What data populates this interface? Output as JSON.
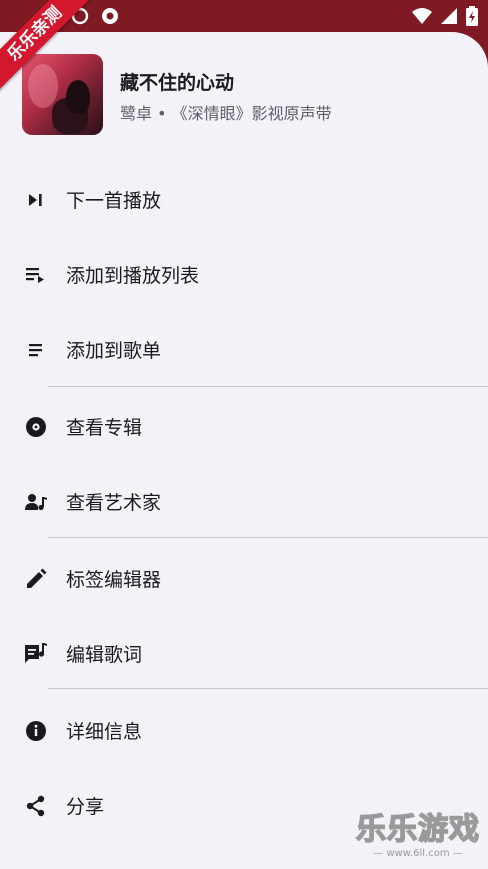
{
  "status_bar": {
    "left_icons": [
      "sync-icon",
      "record-icon"
    ],
    "right_icons": [
      "wifi-icon",
      "signal-icon",
      "battery-charging-icon"
    ]
  },
  "song": {
    "title": "藏不住的心动",
    "subtitle": "鹭卓 • 《深情眼》影视原声带"
  },
  "menu": [
    {
      "label": "下一首播放",
      "icon": "play-next-icon"
    },
    {
      "label": "添加到播放列表",
      "icon": "playlist-add-icon"
    },
    {
      "label": "添加到歌单",
      "icon": "list-icon"
    },
    {
      "label": "查看专辑",
      "icon": "album-icon"
    },
    {
      "label": "查看艺术家",
      "icon": "artist-icon"
    },
    {
      "label": "标签编辑器",
      "icon": "pencil-icon"
    },
    {
      "label": "编辑歌词",
      "icon": "lyrics-icon"
    },
    {
      "label": "详细信息",
      "icon": "info-icon"
    },
    {
      "label": "分享",
      "icon": "share-icon"
    }
  ],
  "ribbon_text": "乐乐亲测",
  "watermark": {
    "title": "乐乐游戏",
    "url": "— www.6ll.com —"
  },
  "colors": {
    "status_bar": "#7e1a24",
    "sheet": "#f3f2f8",
    "ribbon": "#d3182e"
  }
}
